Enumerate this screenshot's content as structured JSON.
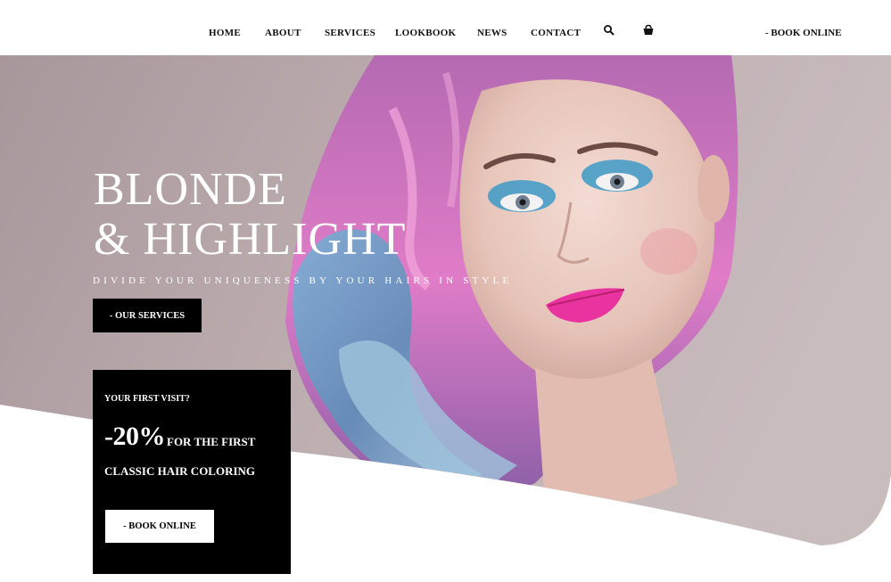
{
  "nav": {
    "home": "HOME",
    "about": "ABOUT",
    "services": "SERVICES",
    "lookbook": "LOOKBOOK",
    "news": "NEWS",
    "contact": "CONTACT",
    "book_online": "- BOOK ONLINE"
  },
  "icons": {
    "search": "search-icon",
    "cart": "cart-icon"
  },
  "hero": {
    "title_line1": "BLONDE",
    "title_line2": "& HIGHLIGHT",
    "tagline": "DIVIDE YOUR UNIQUENESS BY YOUR HAIRS IN STYLE",
    "cta_label": "- OUR SERVICES"
  },
  "promo": {
    "question": "YOUR FIRST VISIT?",
    "discount": "-20%",
    "line1": "FOR THE FIRST",
    "line2": "CLASSIC HAIR COLORING",
    "button_label": "- BOOK ONLINE"
  },
  "colors": {
    "hero_bg": "#b4a3a6",
    "accent_pink": "#e855b8",
    "accent_blue": "#6aa9cf",
    "black": "#000000",
    "white": "#ffffff"
  }
}
